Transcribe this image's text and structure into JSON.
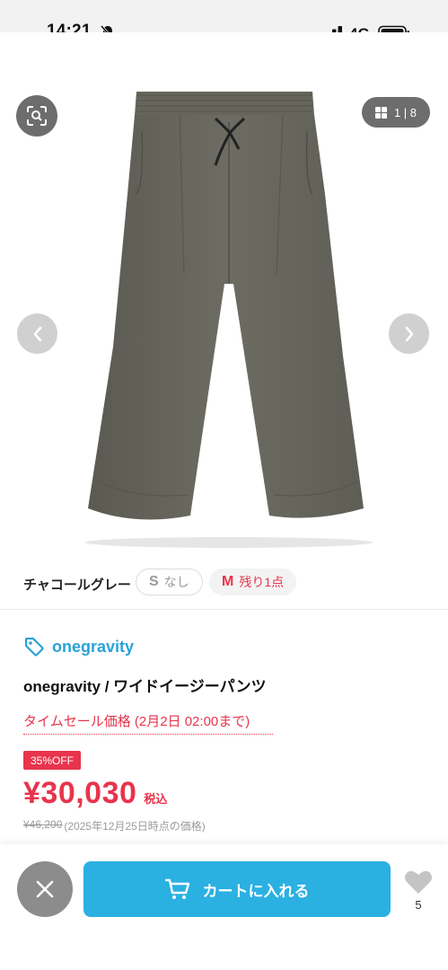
{
  "status_bar": {
    "time": "14:21",
    "network": "4G",
    "icons": [
      "bell-slash-icon",
      "signal-icon",
      "battery-icon"
    ]
  },
  "gallery": {
    "page_counter": "1 | 8",
    "icons": [
      "scan-search-icon",
      "grid-icon",
      "chevron-left-icon",
      "chevron-right-icon"
    ],
    "image_subject": "wide-leg-pants-charcoal-gray"
  },
  "variants": {
    "color_name": "チャコールグレー",
    "sizes": [
      {
        "size": "S",
        "status": "なし",
        "available": false
      },
      {
        "size": "M",
        "status": "残り1点",
        "available": true
      }
    ]
  },
  "product": {
    "brand": "onegravity",
    "title": "onegravity / ワイドイージーパンツ",
    "sale_label": "タイムセール価格 (2月2日 02:00まで)",
    "discount": "35%OFF",
    "price": "¥30,030",
    "tax_label": "税込",
    "old_price": "¥46,200",
    "old_price_note": "(2025年12月25日時点の価格)"
  },
  "bottom_bar": {
    "cart_label": "カートに入れる",
    "like_count": "5",
    "icons": [
      "close-icon",
      "cart-icon",
      "heart-icon"
    ]
  },
  "colors": {
    "accent_blue": "#2bb0e2",
    "brand_blue": "#2aa2d6",
    "sale_red": "#e8344c",
    "muted_gray": "#8c8c8c"
  }
}
